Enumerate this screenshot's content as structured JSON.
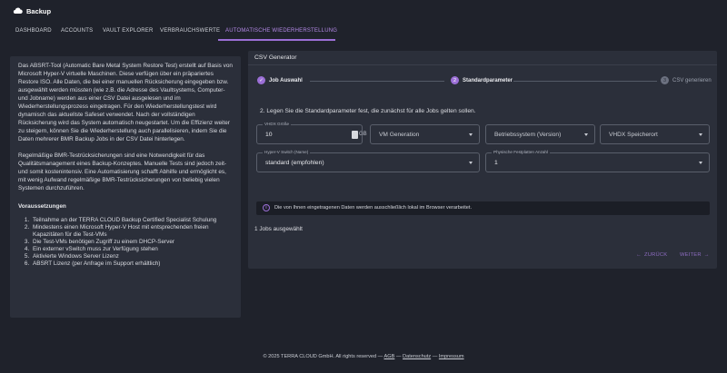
{
  "header": {
    "title": "Backup",
    "icon": "cloud-icon"
  },
  "tabs": [
    {
      "label": "DASHBOARD"
    },
    {
      "label": "ACCOUNTS"
    },
    {
      "label": "VAULT EXPLORER"
    },
    {
      "label": "VERBRAUCHSWERTE"
    },
    {
      "label": "AUTOMATISCHE WIEDERHERSTELLUNG"
    }
  ],
  "info": {
    "paragraph1": "Das ABSRT-Tool (Automatic Bare Metal System Restore Test) erstellt auf Basis von Microsoft Hyper-V virtuelle Maschinen. Diese verfügen über ein präpariertes Restore ISO. Alle Daten, die bei einer manuellen Rücksicherung eingegeben bzw. ausgewählt werden müssten (wie z.B. die Adresse des Vaultsystems, Computer- und Jobname) werden aus einer CSV Datei ausgelesen und im Wiederherstellungsprozess eingetragen. Für den Wiederherstellungstest wird dynamisch das aktuellste Safeset verwendet. Nach der vollständigen Rücksicherung wird das System automatisch neugestartet. Um die Effizienz weiter zu steigern, können Sie die Wiederherstellung auch parallelisieren, indem Sie die Daten mehrerer BMR Backup Jobs in der CSV Datei hinterlegen.",
    "paragraph2": "Regelmäßige BMR-Testrücksicherungen sind eine Notwendigkeit für das Qualitätsmanagement eines Backup-Konzeptes. Manuelle Tests sind jedoch zeit- und somit kostenintensiv. Eine Automatisierung schafft Abhilfe und ermöglicht es, mit wenig Aufwand regelmäßige BMR-Testrücksicherungen von beliebig vielen Systemen durchzuführen.",
    "requirements_title": "Voraussetzungen",
    "requirements": [
      "Teilnahme an der TERRA CLOUD Backup Certified Specialist Schulung",
      "Mindestens einen Microsoft Hyper-V Host mit entsprechenden freien Kapazitäten für die Test-VMs",
      "Die Test-VMs benötigen Zugriff zu einem DHCP-Server",
      "Ein externer vSwitch muss zur Verfügung stehen",
      "Aktivierte Windows Server Lizenz",
      "ABSRT Lizenz (per Anfrage im Support erhältlich)"
    ]
  },
  "csv": {
    "title": "CSV Generator",
    "steps": [
      {
        "number": "✓",
        "label": "Job Auswahl"
      },
      {
        "number": "2",
        "label": "Standardparameter"
      },
      {
        "number": "3",
        "label": "CSV generieren"
      }
    ],
    "instruction": "2. Legen Sie die Standardparameter fest, die zunächst für alle Jobs gelten sollen.",
    "fields": {
      "vhdx_size_label": "VHDX Größe",
      "vhdx_size_value": "10",
      "vhdx_size_unit": "GB",
      "vm_generation": "VM Generation",
      "os_version": "Betriebssystem (Version)",
      "vhdx_location": "VHDX Speicherort",
      "vswitch_label": "Hyper-V Switch (Name)",
      "vswitch_value": "standard (empfohlen)",
      "disk_count_label": "Physische Festplatten Anzahl",
      "disk_count_value": "1"
    },
    "notice": "Die von Ihnen eingetragenen Daten werden ausschließlich lokal im Browser verarbeitet.",
    "jobs_selected": "1 Jobs ausgewählt",
    "back_label": "ZURÜCK",
    "next_label": "WEITER",
    "accent": "#9b6fd6"
  },
  "footer": {
    "copyright": "© 2025 TERRA CLOUD GmbH. All rights reserved —",
    "agb": "AGB",
    "sep1": "—",
    "privacy": "Datenschutz",
    "sep2": "—",
    "imprint": "Impressum"
  }
}
